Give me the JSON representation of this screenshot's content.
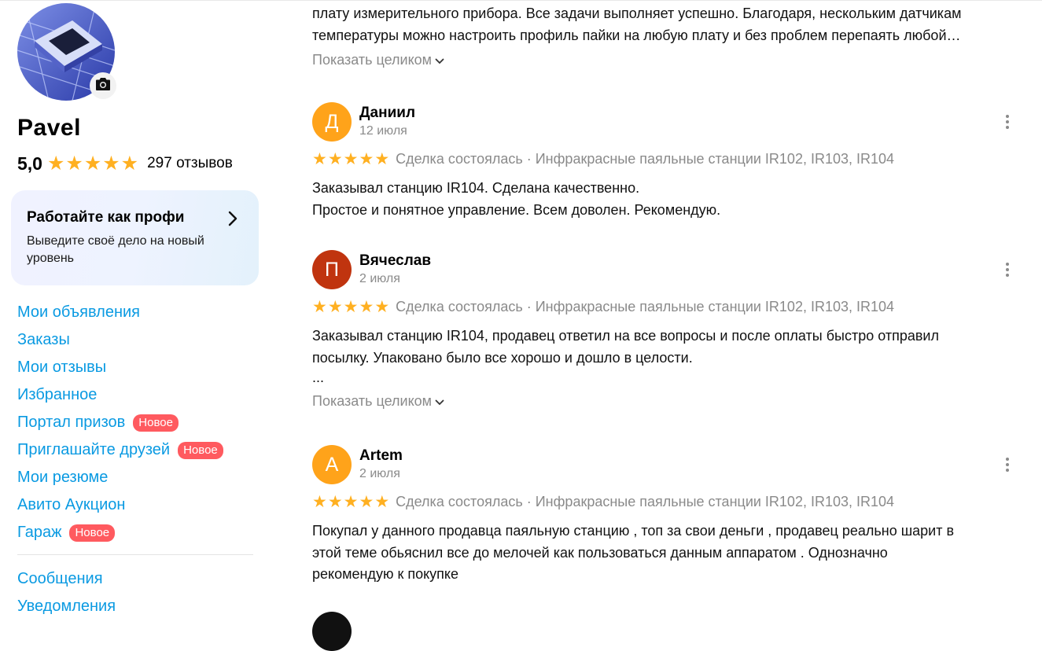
{
  "profile": {
    "name": "Pavel",
    "rating": "5,0",
    "reviews_count": "297 отзывов"
  },
  "promo": {
    "title": "Работайте как профи",
    "text": "Выведите своё дело на новый уровень"
  },
  "menu": {
    "items": [
      {
        "label": "Мои объявления"
      },
      {
        "label": "Заказы"
      },
      {
        "label": "Мои отзывы"
      },
      {
        "label": "Избранное"
      },
      {
        "label": "Портал призов",
        "badge": "Новое"
      },
      {
        "label": "Приглашайте друзей",
        "badge": "Новое"
      },
      {
        "label": "Мои резюме"
      },
      {
        "label": "Авито Аукцион"
      },
      {
        "label": "Гараж",
        "badge": "Новое"
      }
    ],
    "secondary": [
      {
        "label": "Сообщения"
      },
      {
        "label": "Уведомления"
      }
    ]
  },
  "partial_review": {
    "line1": "плату измерительного прибора. Все задачи выполняет успешно. Благодаря, нескольким датчикам",
    "line2": "температуры можно настроить профиль пайки на любую плату и без проблем перепаять любой…",
    "show_more": "Показать целиком"
  },
  "reviews": [
    {
      "initial": "Д",
      "avatar_color": "#ffa31a",
      "author": "Даниил",
      "date": "12 июля",
      "stars": 5,
      "meta": "Сделка состоялась · Инфракрасные паяльные станции IR102, IR103, IR104",
      "lines": [
        "Заказывал станцию IR104. Сделана качественно.",
        "Простое и понятное управление. Всем доволен. Рекомендую."
      ]
    },
    {
      "initial": "П",
      "avatar_color": "#c0340f",
      "author": "Вячеслав",
      "date": "2 июля",
      "stars": 5,
      "meta": "Сделка состоялась · Инфракрасные паяльные станции IR102, IR103, IR104",
      "lines": [
        "Заказывал станцию IR104, продавец ответил на все вопросы и после оплаты быстро отправил",
        "посылку. Упаковано было все хорошо и дошло в целости.",
        "..."
      ],
      "show_more": "Показать целиком"
    },
    {
      "initial": "A",
      "avatar_color": "#ffa31a",
      "author": "Artem",
      "date": "2 июля",
      "stars": 5,
      "meta": "Сделка состоялась · Инфракрасные паяльные станции IR102, IR103, IR104",
      "lines": [
        "Покупал у данного продавца паяльную станцию , топ за свои деньги , продавец реально шарит в",
        "этой теме обьяснил все до мелочей как пользоваться данным аппаратом . Однозначно",
        "рекомендую к покупке"
      ]
    }
  ],
  "icons": {
    "camera": "camera-icon",
    "chevron_right": "chevron-right-icon",
    "chevron_down": "chevron-down-icon",
    "more": "more-vertical-icon",
    "star": "star-icon"
  },
  "colors": {
    "link": "#0a9ae2",
    "badge": "#ff5a5f",
    "star": "#ffb021",
    "muted": "#8a8a8a"
  }
}
